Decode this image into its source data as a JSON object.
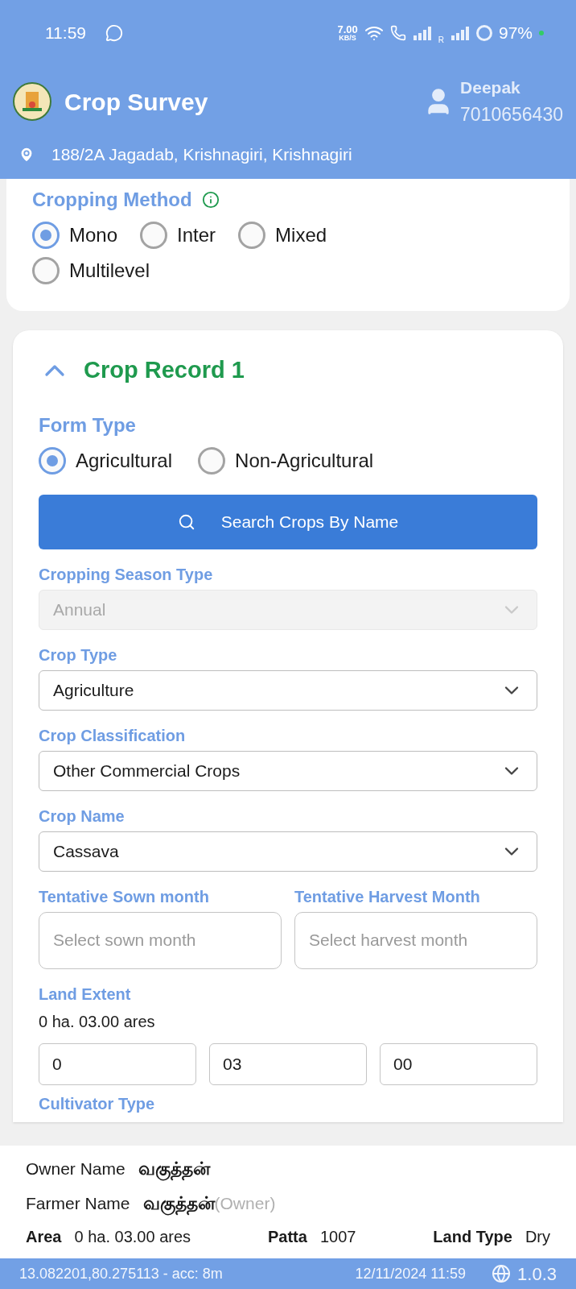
{
  "status_bar": {
    "time": "11:59",
    "speed": "7.00",
    "speed_unit": "KB/S",
    "roaming": "R",
    "battery": "97%"
  },
  "header": {
    "title": "Crop Survey",
    "user_name": "Deepak",
    "user_phone": "7010656430",
    "address": "188/2A Jagadab, Krishnagiri, Krishnagiri"
  },
  "cropping_method": {
    "label": "Cropping Method",
    "options": [
      {
        "label": "Mono",
        "selected": true
      },
      {
        "label": "Inter",
        "selected": false
      },
      {
        "label": "Mixed",
        "selected": false
      },
      {
        "label": "Multilevel",
        "selected": false
      }
    ]
  },
  "crop_record": {
    "title": "Crop Record 1",
    "expanded": true,
    "form_type": {
      "label": "Form Type",
      "options": [
        {
          "label": "Agricultural",
          "selected": true
        },
        {
          "label": "Non-Agricultural",
          "selected": false
        }
      ]
    },
    "search_button": "Search Crops By Name",
    "selects": [
      {
        "label": "Cropping Season Type",
        "value": "Annual",
        "disabled": true
      },
      {
        "label": "Crop Type",
        "value": "Agriculture",
        "disabled": false
      },
      {
        "label": "Crop Classification",
        "value": "Other Commercial Crops",
        "disabled": false
      },
      {
        "label": "Crop Name",
        "value": "Cassava",
        "disabled": false
      }
    ],
    "months": [
      {
        "label": "Tentative Sown month",
        "placeholder": "Select sown month"
      },
      {
        "label": "Tentative Harvest Month",
        "placeholder": "Select harvest month"
      }
    ],
    "land_extent": {
      "label": "Land Extent",
      "summary": "0 ha. 03.00 ares",
      "values": [
        "0",
        "03",
        "00"
      ]
    },
    "cultivator_type": {
      "label": "Cultivator Type"
    }
  },
  "owner_panel": {
    "owner_label": "Owner Name",
    "owner_value": "வகுத்தன்",
    "farmer_label": "Farmer Name",
    "farmer_value": "வகுத்தன்",
    "farmer_role": "(Owner)",
    "facts": [
      {
        "label": "Area",
        "value": "0 ha. 03.00 ares"
      },
      {
        "label": "Patta",
        "value": "1007"
      },
      {
        "label": "Land Type",
        "value": "Dry"
      }
    ]
  },
  "footer": {
    "location": "13.082201,80.275113 - acc: 8m",
    "datetime": "12/11/2024 11:59",
    "version": "1.0.3"
  }
}
